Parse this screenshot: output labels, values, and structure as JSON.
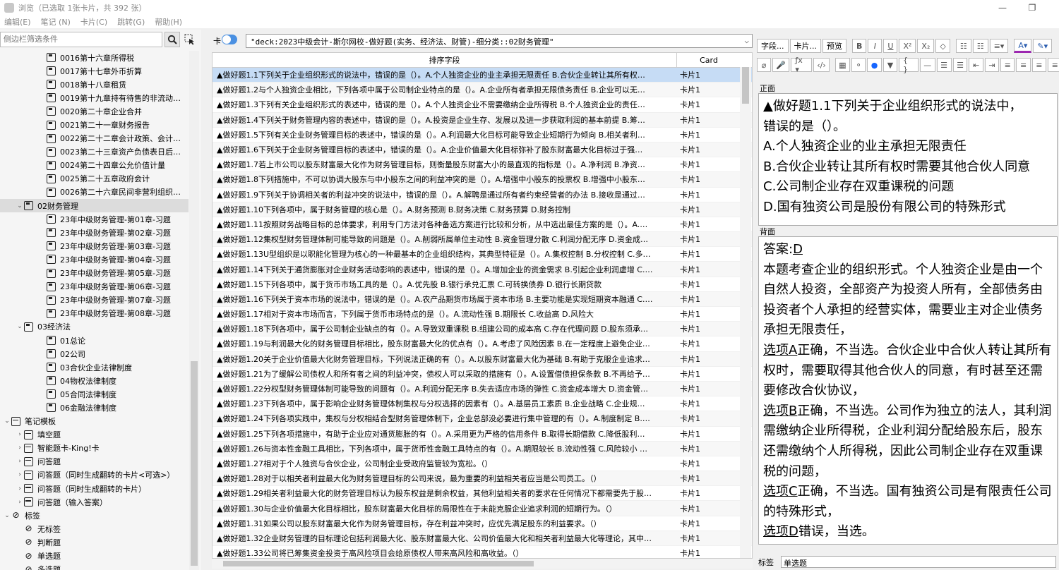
{
  "window": {
    "title": "浏览（已选取 1张卡片，共 392 张）",
    "minimize_glyph": "—",
    "restore_glyph": "❐"
  },
  "menu": [
    "编辑(E)",
    "笔记 (N)",
    "卡片(C)",
    "跳转(G)",
    "帮助(H)"
  ],
  "sidebar": {
    "search_placeholder": "侧边栏筛选条件",
    "tree": [
      {
        "label": "0016第十六章所得税",
        "indent": 2,
        "icon": "card"
      },
      {
        "label": "0017第十七章外币折算",
        "indent": 2,
        "icon": "card"
      },
      {
        "label": "0018第十八章租赁",
        "indent": 2,
        "icon": "card"
      },
      {
        "label": "0019第十九章持有待售的非流动…",
        "indent": 2,
        "icon": "card"
      },
      {
        "label": "0020第二十章企业合并",
        "indent": 2,
        "icon": "card"
      },
      {
        "label": "0021第二十一章财务报告",
        "indent": 2,
        "icon": "card"
      },
      {
        "label": "0022第二十二章会计政策、会计…",
        "indent": 2,
        "icon": "card"
      },
      {
        "label": "0023第二十三章资产负债表日后…",
        "indent": 2,
        "icon": "card"
      },
      {
        "label": "0024第二十四章公允价值计量",
        "indent": 2,
        "icon": "card"
      },
      {
        "label": "0025第二十五章政府会计",
        "indent": 2,
        "icon": "card"
      },
      {
        "label": "0026第二十六章民间非营利组织…",
        "indent": 2,
        "icon": "card"
      },
      {
        "label": "02财务管理",
        "indent": 1,
        "icon": "card",
        "arrow": "v",
        "selected": true
      },
      {
        "label": "23年中级财务管理-第01章-习题",
        "indent": 2,
        "icon": "card"
      },
      {
        "label": "23年中级财务管理-第02章-习题",
        "indent": 2,
        "icon": "card"
      },
      {
        "label": "23年中级财务管理-第03章-习题",
        "indent": 2,
        "icon": "card"
      },
      {
        "label": "23年中级财务管理-第04章-习题",
        "indent": 2,
        "icon": "card"
      },
      {
        "label": "23年中级财务管理-第05章-习题",
        "indent": 2,
        "icon": "card"
      },
      {
        "label": "23年中级财务管理-第06章-习题",
        "indent": 2,
        "icon": "card"
      },
      {
        "label": "23年中级财务管理-第07章-习题",
        "indent": 2,
        "icon": "card"
      },
      {
        "label": "23年中级财务管理-第08章-习题",
        "indent": 2,
        "icon": "card"
      },
      {
        "label": "03经济法",
        "indent": 1,
        "icon": "card",
        "arrow": "v"
      },
      {
        "label": "01总论",
        "indent": 2,
        "icon": "card"
      },
      {
        "label": "02公司",
        "indent": 2,
        "icon": "card"
      },
      {
        "label": "03合伙企业法律制度",
        "indent": 2,
        "icon": "card"
      },
      {
        "label": "04物权法律制度",
        "indent": 2,
        "icon": "card"
      },
      {
        "label": "05合同法律制度",
        "indent": 2,
        "icon": "card"
      },
      {
        "label": "06金融法律制度",
        "indent": 2,
        "icon": "card"
      },
      {
        "label": "笔记模板",
        "indent": 0,
        "icon": "model",
        "arrow": "v"
      },
      {
        "label": "填空题",
        "indent": 1,
        "icon": "model",
        "arrow": ">"
      },
      {
        "label": "智能题卡-King!卡",
        "indent": 1,
        "icon": "model",
        "arrow": ">"
      },
      {
        "label": "问答题",
        "indent": 1,
        "icon": "model",
        "arrow": ">"
      },
      {
        "label": "问答题（同时生成翻转的卡片<可选>）",
        "indent": 1,
        "icon": "model",
        "arrow": ">"
      },
      {
        "label": "问答题（同时生成翻转的卡片）",
        "indent": 1,
        "icon": "model",
        "arrow": ">"
      },
      {
        "label": "问答题（输入答案）",
        "indent": 1,
        "icon": "model",
        "arrow": ">"
      },
      {
        "label": "标签",
        "indent": 0,
        "icon": "tag",
        "arrow": "v"
      },
      {
        "label": "无标签",
        "indent": 1,
        "icon": "tag"
      },
      {
        "label": "判断题",
        "indent": 1,
        "icon": "tag"
      },
      {
        "label": "单选题",
        "indent": 1,
        "icon": "tag"
      },
      {
        "label": "多选题",
        "indent": 1,
        "icon": "tag"
      }
    ]
  },
  "browser": {
    "toggle_label": "卡",
    "search_query": "\"deck:2023中级会计-斯尔网校-做好题(实务、经济法、财管)-细分类::02财务管理\"",
    "columns": [
      "排序字段",
      "Card"
    ],
    "rows": [
      {
        "sort": "▲做好题1.1下列关于企业组织形式的说法中，错误的是（）。A.个人独资企业的业主承担无限责任 B.合伙企业转让其所有权…",
        "card": "卡片1",
        "selected": true
      },
      {
        "sort": "▲做好题1.2与个人独资企业相比，下列各项中属于公司制企业特点的是（）。A.企业所有者承担无限债务责任 B.企业可以无…",
        "card": "卡片1"
      },
      {
        "sort": "▲做好题1.3下列有关企业组织形式的表述中，错误的是（）。A.个人独资企业不需要缴纳企业所得税 B.个人独资企业的责任…",
        "card": "卡片1"
      },
      {
        "sort": "▲做好题1.4下列关于财务管理内容的表述中，错误的是（）。A.投资是企业生存、发展以及进一步获取利润的基本前提 B.筹…",
        "card": "卡片1"
      },
      {
        "sort": "▲做好题1.5下列有关企业财务管理目标的表述中，错误的是（）。A.利润最大化目标可能导致企业短期行为倾向 B.相关者利…",
        "card": "卡片1"
      },
      {
        "sort": "▲做好题1.6下列关于企业财务管理目标的表述中，错误的是（）。A.企业价值最大化目标弥补了股东财富最大化目标过于强…",
        "card": "卡片1"
      },
      {
        "sort": "▲做好题1.7若上市公司以股东财富最大化作为财务管理目标，则衡量股东财富大小的最直观的指标是（）。A.净利润 B.净资…",
        "card": "卡片1"
      },
      {
        "sort": "▲做好题1.8下列措施中，不可以协调大股东与中小股东之间的利益冲突的是（）。A.增强中小股东的投票权 B.增强中小股东…",
        "card": "卡片1"
      },
      {
        "sort": "▲做好题1.9下列关于协调相关者的利益冲突的说法中，错误的是（）。A.解聘是通过所有者约束经营者的办法 B.接收是通过…",
        "card": "卡片1"
      },
      {
        "sort": "▲做好题1.10下列各项中，属于财务管理的核心是（）。A.财务预测 B.财务决策 C.财务预算 D.财务控制",
        "card": "卡片1"
      },
      {
        "sort": "▲做好题1.11按照财务战略目标的总体要求，利用专门方法对各种备选方案进行比较和分析，从中选出最佳方案的是（）。A.…",
        "card": "卡片1"
      },
      {
        "sort": "▲做好题1.12集权型财务管理体制可能导致的问题是（）。A.削弱所属单位主动性 B.资金管理分散 C.利润分配无序 D.资金成…",
        "card": "卡片1"
      },
      {
        "sort": "▲做好题1.13U型组织是以职能化管理为核心的一种最基本的企业组织结构，其典型特征是（）。A.集权控制 B.分权控制 C.多…",
        "card": "卡片1"
      },
      {
        "sort": "▲做好题1.14下列关于通货膨胀对企业财务活动影响的表述中，错误的是（）。A.增加企业的资金需求 B.引起企业利润虚增 C.…",
        "card": "卡片1"
      },
      {
        "sort": "▲做好题1.15下列各项中，属于货币市场工具的是（）。A.优先股 B.银行承兑汇票 C.可转换债券 D.银行长期贷款",
        "card": "卡片1"
      },
      {
        "sort": "▲做好题1.16下列关于资本市场的说法中，错误的是（）。A.农产品期货市场属于资本市场 B.主要功能是实现短期资本融通 C.…",
        "card": "卡片1"
      },
      {
        "sort": "▲做好题1.17相对于资本市场而言，下列属于货币市场特点的是（）。A.流动性强 B.期限长 C.收益高 D.风险大",
        "card": "卡片1"
      },
      {
        "sort": "▲做好题1.18下列各项中，属于公司制企业缺点的有（）。A.导致双重课税 B.组建公司的成本高 C.存在代理问题 D.股东须承…",
        "card": "卡片1"
      },
      {
        "sort": "▲做好题1.19与利润最大化的财务管理目标相比，股东财富最大化的优点有（）。A.考虑了风险因素 B.在一定程度上避免企业…",
        "card": "卡片1"
      },
      {
        "sort": "▲做好题1.20关于企业价值最大化财务管理目标，下列说法正确的有（）。A.以股东财富最大化为基础 B.有助于克服企业追求…",
        "card": "卡片1"
      },
      {
        "sort": "▲做好题1.21为了缓解公司债权人和所有者之间的利益冲突，债权人可以采取的措施有（）。A.设置借债担保条款 B.不再给予…",
        "card": "卡片1"
      },
      {
        "sort": "▲做好题1.22分权型财务管理体制可能导致的问题有（）。A.利润分配无序 B.失去适应市场的弹性 C.资金成本增大 D.资金管…",
        "card": "卡片1"
      },
      {
        "sort": "▲做好题1.23下列各项中，属于影响企业财务管理体制集权与分权选择的因素有（）。A.基层员工素质 B.企业战略 C.企业规…",
        "card": "卡片1"
      },
      {
        "sort": "▲做好题1.24下列各项实践中，集权与分权相结合型财务管理体制下，企业总部没必要进行集中管理的有（）。A.制度制定 B.…",
        "card": "卡片1"
      },
      {
        "sort": "▲做好题1.25下列各项措施中，有助于企业应对通货膨胀的有（）。A.采用更为严格的信用条件 B.取得长期借款 C.降低股利…",
        "card": "卡片1"
      },
      {
        "sort": "▲做好题1.26与资本性金融工具相比，下列各项中，属于货币性金融工具特点的有（）。A.期限较长 B.流动性强 C.风险较小 …",
        "card": "卡片1"
      },
      {
        "sort": "▲做好题1.27相对于个人独资与合伙企业，公司制企业受政府监管较为宽松。（）",
        "card": "卡片1"
      },
      {
        "sort": "▲做好题1.28对于以相关者利益最大化为财务管理目标的公司来说，最为重要的利益相关者应当是公司员工。（）",
        "card": "卡片1"
      },
      {
        "sort": "▲做好题1.29相关者利益最大化的财务管理目标认为股东权益是剩余权益，其他利益相关者的要求在任何情况下都需要先于股…",
        "card": "卡片1"
      },
      {
        "sort": "▲做好题1.30与企业价值最大化目标相比，股东财富最大化目标的局限性在于未能克服企业追求利润的短期行为。（）",
        "card": "卡片1"
      },
      {
        "sort": "▲做好题1.31如果公司以股东财富最大化作为财务管理目标，存在利益冲突时，应优先满足股东的利益要求。（）",
        "card": "卡片1"
      },
      {
        "sort": "▲做好题1.32企业财务管理的目标理论包括利润最大化、股东财富最大化、公司价值最大化和相关者利益最大化等理论，其中…",
        "card": "卡片1"
      },
      {
        "sort": "▲做好题1.33公司将已筹集资金投资于高风险项目会给原债权人带来高风险和高收益。（）",
        "card": "卡片1"
      }
    ]
  },
  "editor": {
    "toolbar": {
      "fields_btn": "字段...",
      "cards_btn": "卡片...",
      "preview_btn": "预览",
      "bold": "B",
      "italic": "I",
      "underline": "U",
      "superscript": "X²",
      "subscript": "X₂",
      "row2": [
        "⌀",
        "🎤",
        "ƒx ▾",
        "‹/›",
        "▦",
        "⚬",
        "●",
        "▼",
        "{ }",
        "—",
        "☰",
        "☰",
        "⇤",
        "⇥",
        "≡",
        "≡",
        "≡",
        "≡"
      ]
    },
    "front_label": "正面",
    "front_lines": [
      "▲做好题1.1下列关于企业组织形式的说法中，",
      "错误的是（）。",
      "A.个人独资企业的业主承担无限责任",
      "B.合伙企业转让其所有权时需要其他合伙人同意",
      "C.公司制企业存在双重课税的问题",
      "D.国有独资公司是股份有限公司的特殊形式"
    ],
    "back_label": "背面",
    "back": {
      "answer_prefix": "答案:",
      "answer_value": "D",
      "paragraph1": "本题考查企业的组织形式。个人独资企业是由一个自然人投资，全部资产为投资人所有，全部债务由投资者个人承担的经营实体，需要业主对企业债务承担无限责任，",
      "optA_link": "选项A",
      "optA_text": "正确，不当选。合伙企业中合伙人转让其所有权时，需要取得其他合伙人的同意，有时甚至还需要修改合伙协议，",
      "optB_link": "选项B",
      "optB_text": "正确，不当选。公司作为独立的法人，其利润需缴纳企业所得税，企业利润分配给股东后，股东还需缴纳个人所得税，因此公司制企业存在双重课税的问题，",
      "optC_link": "选项C",
      "optC_text": "正确，不当选。国有独资公司是有限责任公司的特殊形式，",
      "optD_link": "选项D",
      "optD_text": "错误，当选。"
    },
    "tag_label": "标签",
    "tag_value": "单选题"
  }
}
